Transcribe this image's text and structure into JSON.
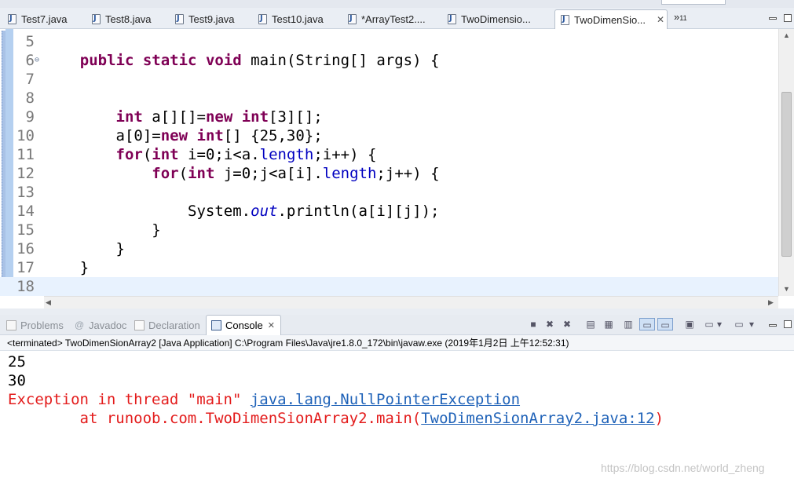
{
  "editor_tabs": [
    {
      "label": "Test7.java",
      "icon": "java-file-icon"
    },
    {
      "label": "Test8.java",
      "icon": "java-file-icon"
    },
    {
      "label": "Test9.java",
      "icon": "java-file-icon"
    },
    {
      "label": "Test10.java",
      "icon": "java-file-icon"
    },
    {
      "label": "*ArrayTest2....",
      "icon": "java-file-icon"
    },
    {
      "label": "TwoDimensio...",
      "icon": "java-file-icon"
    },
    {
      "label": "TwoDimenSio...",
      "icon": "java-file-icon",
      "active": true,
      "close": "✕"
    }
  ],
  "tab_overflow": {
    "symbol": "»",
    "count": "11"
  },
  "code_lines": [
    {
      "num": "5",
      "text": ""
    },
    {
      "num": "6",
      "text": "    public static void main(String[] args) {",
      "fold": "⊖"
    },
    {
      "num": "7",
      "text": ""
    },
    {
      "num": "8",
      "text": ""
    },
    {
      "num": "9",
      "text": "        int a[][]=new int[3][];"
    },
    {
      "num": "10",
      "text": "        a[0]=new int[] {25,30};"
    },
    {
      "num": "11",
      "text": "        for(int i=0;i<a.length;i++) {"
    },
    {
      "num": "12",
      "text": "            for(int j=0;j<a[i].length;j++) {"
    },
    {
      "num": "13",
      "text": ""
    },
    {
      "num": "14",
      "text": "                System.out.println(a[i][j]);"
    },
    {
      "num": "15",
      "text": "            }"
    },
    {
      "num": "16",
      "text": "        }"
    },
    {
      "num": "17",
      "text": "    }"
    },
    {
      "num": "18",
      "text": "",
      "current": true
    }
  ],
  "console_tabs": [
    {
      "label": "Problems",
      "icon": "problems-icon"
    },
    {
      "label": "Javadoc",
      "icon": "javadoc-icon"
    },
    {
      "label": "Declaration",
      "icon": "declaration-icon"
    },
    {
      "label": "Console",
      "icon": "console-icon",
      "active": true,
      "close": "✕"
    }
  ],
  "console_status": "<terminated> TwoDimenSionArray2 [Java Application] C:\\Program Files\\Java\\jre1.8.0_172\\bin\\javaw.exe (2019年1月2日 上午12:52:31)",
  "console_output": {
    "line1": "25",
    "line2": "30",
    "exception_prefix": "Exception in thread \"main\" ",
    "exception_link": "java.lang.NullPointerException",
    "stack_prefix": "        at runoob.com.TwoDimenSionArray2.main(",
    "stack_link": "TwoDimenSionArray2.java:12",
    "stack_suffix": ")"
  },
  "watermark": "https://blog.csdn.net/world_zheng",
  "colors": {
    "keyword": "#7f0055",
    "field": "#0000c0",
    "error": "#e31b1b",
    "link": "#1f62b8"
  }
}
